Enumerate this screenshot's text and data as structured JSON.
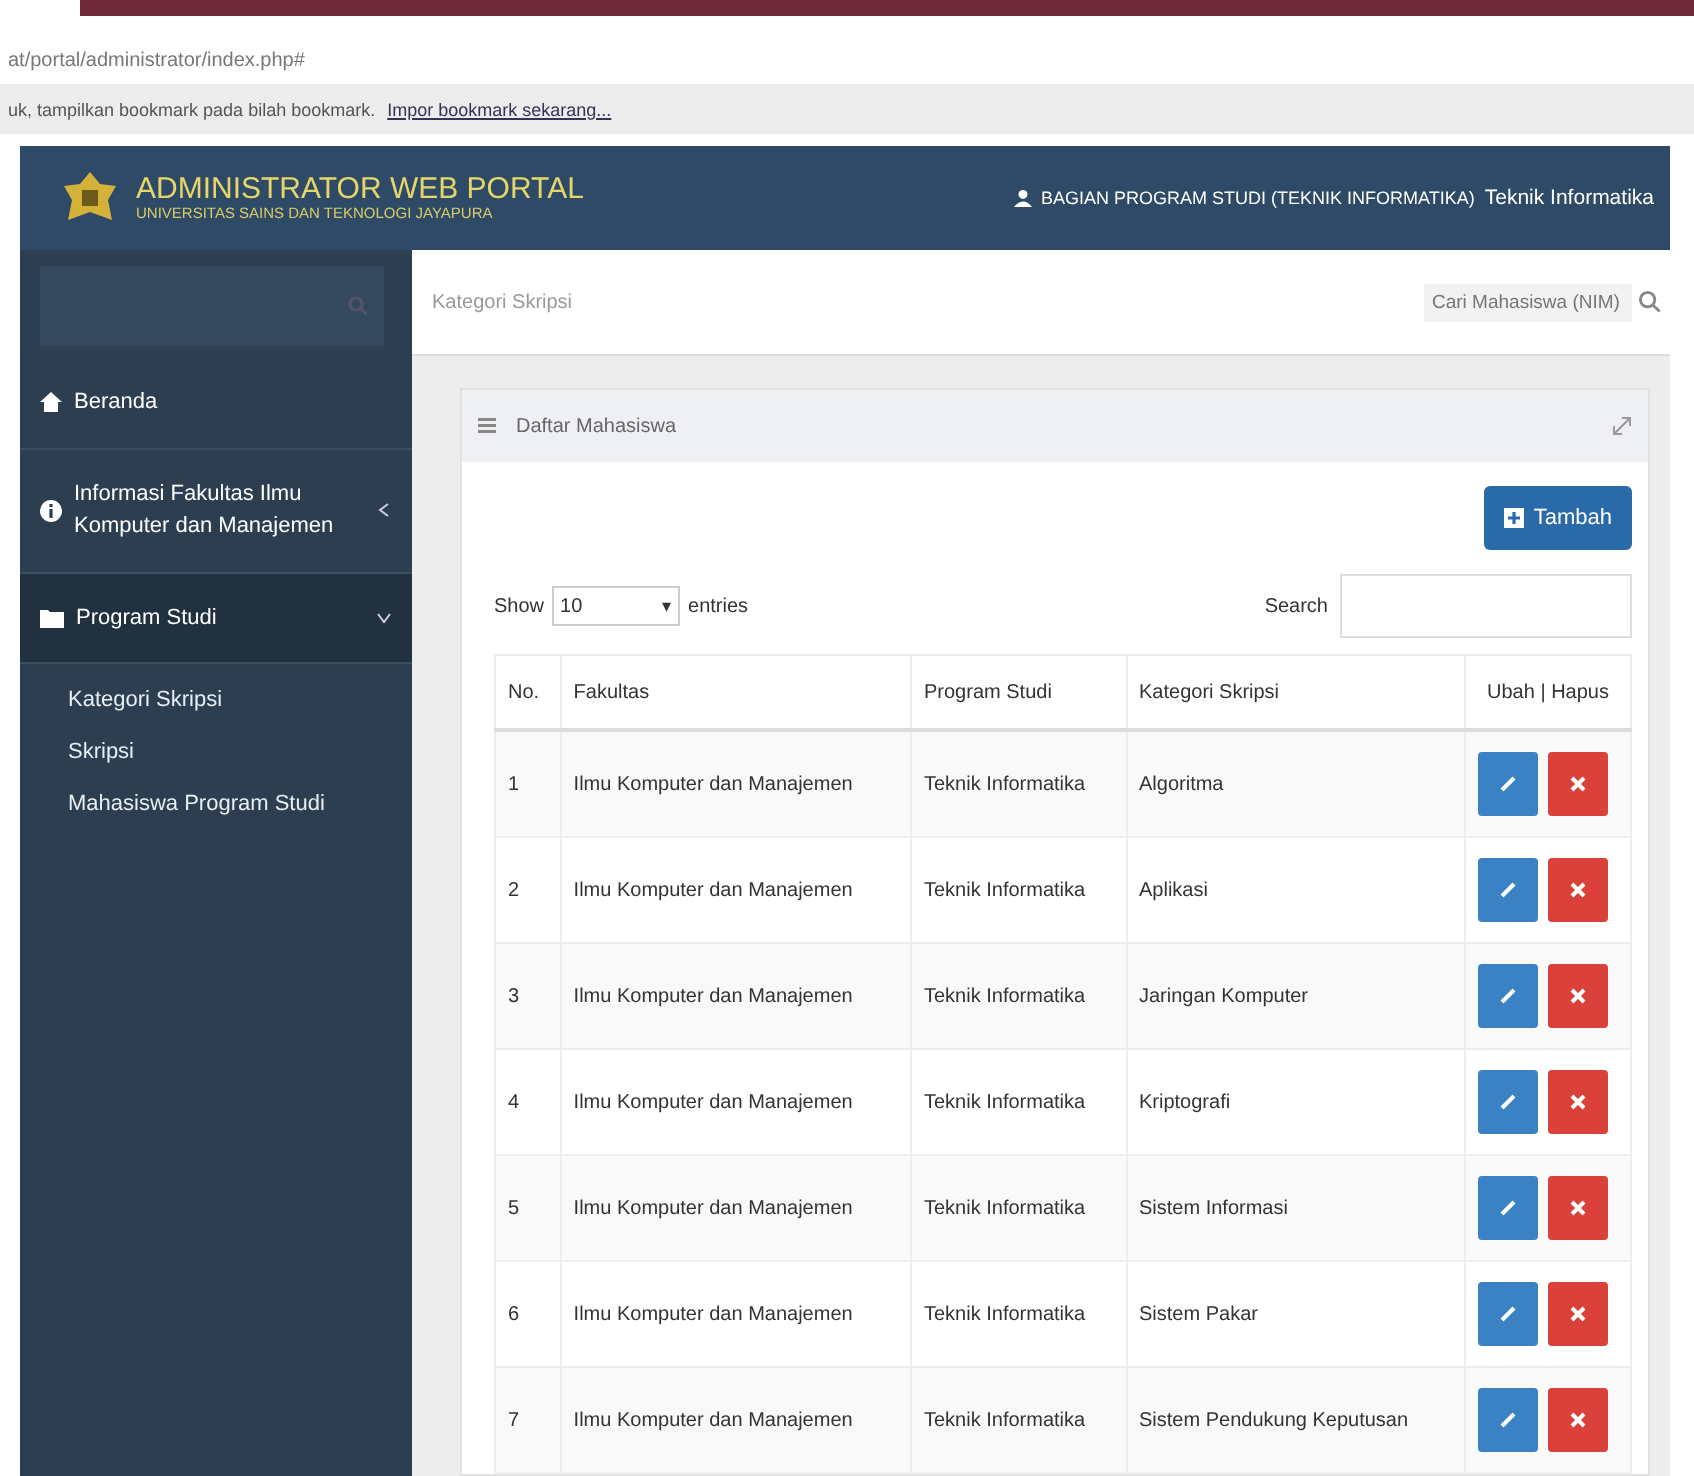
{
  "browser": {
    "url": "at/portal/administrator/index.php#",
    "bookmark_notice": "uk, tampilkan bookmark pada bilah bookmark.",
    "bookmark_link": "Impor bookmark sekarang..."
  },
  "header": {
    "title": "ADMINISTRATOR WEB PORTAL",
    "subtitle": "UNIVERSITAS SAINS DAN TEKNOLOGI JAYAPURA",
    "role": "BAGIAN PROGRAM STUDI (TEKNIK INFORMATIKA)",
    "user": "Teknik Informatika"
  },
  "toolbar": {
    "breadcrumb": "Kategori Skripsi",
    "search_placeholder": "Cari Mahasiswa (NIM)"
  },
  "sidebar": {
    "items": [
      {
        "label": "Beranda",
        "kind": "home",
        "expanded": false
      },
      {
        "label": "Informasi Fakultas Ilmu Komputer dan Manajemen",
        "kind": "info",
        "expanded": false
      },
      {
        "label": "Program Studi",
        "kind": "folder",
        "expanded": true,
        "children": [
          {
            "label": "Kategori Skripsi"
          },
          {
            "label": "Skripsi"
          },
          {
            "label": "Mahasiswa Program Studi"
          }
        ]
      }
    ]
  },
  "panel": {
    "title": "Daftar Mahasiswa",
    "add_button": "Tambah",
    "show_label": "Show",
    "page_size": "10",
    "select_arrow": "▾",
    "entries_label": "entries",
    "search_label": "Search",
    "table": {
      "columns": [
        "No.",
        "Fakultas",
        "Program Studi",
        "Kategori Skripsi",
        "Ubah | Hapus"
      ],
      "rows": [
        [
          "1",
          "Ilmu Komputer dan Manajemen",
          "Teknik Informatika",
          "Algoritma"
        ],
        [
          "2",
          "Ilmu Komputer dan Manajemen",
          "Teknik Informatika",
          "Aplikasi"
        ],
        [
          "3",
          "Ilmu Komputer dan Manajemen",
          "Teknik Informatika",
          "Jaringan Komputer"
        ],
        [
          "4",
          "Ilmu Komputer dan Manajemen",
          "Teknik Informatika",
          "Kriptografi"
        ],
        [
          "5",
          "Ilmu Komputer dan Manajemen",
          "Teknik Informatika",
          "Sistem Informasi"
        ],
        [
          "6",
          "Ilmu Komputer dan Manajemen",
          "Teknik Informatika",
          "Sistem Pakar"
        ],
        [
          "7",
          "Ilmu Komputer dan Manajemen",
          "Teknik Informatika",
          "Sistem Pendukung Keputusan"
        ]
      ]
    }
  }
}
